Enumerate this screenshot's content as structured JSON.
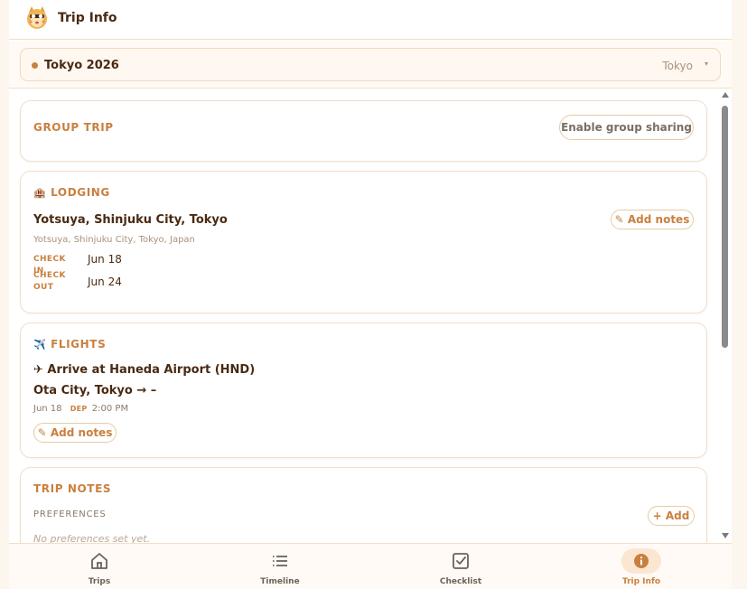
{
  "header": {
    "title": "Trip Info",
    "logo_icon": "mascot-logo"
  },
  "trip_selector": {
    "name": "Tokyo 2026",
    "city": "Tokyo",
    "caret": "▾"
  },
  "group": {
    "title": "GROUP TRIP",
    "button": "Enable group sharing"
  },
  "lodging": {
    "emoji": "🏨",
    "title": "LODGING",
    "name": "Yotsuya, Shinjuku City, Tokyo",
    "address": "Yotsuya, Shinjuku City, Tokyo, Japan",
    "add_notes": "Add notes",
    "check_in_label": "CHECK IN",
    "check_in": "Jun 18",
    "check_out_label": "CHECK OUT",
    "check_out": "Jun 24"
  },
  "flights": {
    "emoji": "✈️",
    "title": "FLIGHTS",
    "line1": "✈ Arrive at Haneda Airport (HND)",
    "line2": "Ota City, Tokyo → –",
    "date": "Jun 18",
    "dep_label": "DEP",
    "dep_time": "2:00 PM",
    "add_notes": "Add notes"
  },
  "notes": {
    "title": "TRIP NOTES",
    "preferences_label": "PREFERENCES",
    "add_button": "+ Add",
    "empty": "No preferences set yet."
  },
  "nav": {
    "items": [
      {
        "label": "Trips",
        "icon": "home-icon"
      },
      {
        "label": "Timeline",
        "icon": "list-icon"
      },
      {
        "label": "Checklist",
        "icon": "checkbox-icon"
      },
      {
        "label": "Trip Info",
        "icon": "info-icon"
      }
    ],
    "active": "Trip Info"
  },
  "colors": {
    "accent": "#c9803f",
    "text": "#4a2a12",
    "border": "#efdfcd",
    "background": "#fcf6ef"
  }
}
